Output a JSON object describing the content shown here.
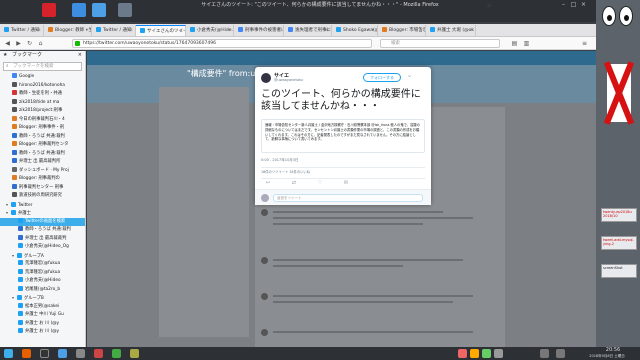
{
  "window": {
    "title": "サイエさんのツイート: \"このツイート、何らかの構成要件に該当してませんかね・・・\" - Mozilla Firefox"
  },
  "tabs": [
    {
      "label": "Twitter / 通知"
    },
    {
      "label": "Blogger: 教師・生"
    },
    {
      "label": "Twitter / 通知"
    },
    {
      "label": "サイエさんのツイー"
    },
    {
      "label": "小倉秀夫(@Hide..."
    },
    {
      "label": "刑事事件の被害者に"
    },
    {
      "label": "逸失理者で刑事になる"
    },
    {
      "label": "Shoko Egawa(@"
    },
    {
      "label": "Blogger: 市場告示"
    },
    {
      "label": "弁護士 大堀 (@ok"
    }
  ],
  "url": "https://twitter.com/uwaoyonetoku/status/17647093607496",
  "search_placeholder": "検索",
  "sidebar": {
    "title": "ブックマーク",
    "search_placeholder": "ブックマークを検索",
    "items": [
      {
        "label": "Google",
        "color": "#4285f4",
        "selected": false,
        "indent": 2
      },
      {
        "label": "hirono2016/kotonoha",
        "color": "#555555",
        "selected": false,
        "indent": 2
      },
      {
        "label": "教師・生徒を利・共通",
        "color": "#d33333",
        "selected": false,
        "indent": 2
      },
      {
        "label": "zik2018/tide at ma",
        "color": "#555555",
        "selected": false,
        "indent": 2
      },
      {
        "label": "zik2018/project:刑事",
        "color": "#555555",
        "selected": false,
        "indent": 2
      },
      {
        "label": "今日の刑事裁判石川・4",
        "color": "#e07b22",
        "selected": false,
        "indent": 2
      },
      {
        "label": "Blogger: 刑事事件・刑",
        "color": "#e07b22",
        "selected": false,
        "indent": 2
      },
      {
        "label": "教師・ろうば 共通:裁判",
        "color": "#2f6fd1",
        "selected": false,
        "indent": 2
      },
      {
        "label": "Blogger: 刑事裁判センタ",
        "color": "#e07b22",
        "selected": false,
        "indent": 2
      },
      {
        "label": "教師・ろうば 共通:裁判",
        "color": "#2f6fd1",
        "selected": false,
        "indent": 2
      },
      {
        "label": "弁理士 出 最高裁判所",
        "color": "#2f6fd1",
        "selected": false,
        "indent": 2
      },
      {
        "label": "ダッシュボード · My Proj",
        "color": "#666666",
        "selected": false,
        "indent": 2
      },
      {
        "label": "Blogger: 刑事裁判の",
        "color": "#e07b22",
        "selected": false,
        "indent": 2
      },
      {
        "label": "刑事裁判センター 刑事",
        "color": "#2f6fd1",
        "selected": false,
        "indent": 2
      },
      {
        "label": "鉄道技術の周研究研究",
        "color": "#555555",
        "selected": false,
        "indent": 2
      },
      {
        "label": "Twitter",
        "color": "#1da1f2",
        "selected": false,
        "indent": 1,
        "folder": true
      },
      {
        "label": "弁護士",
        "color": "#1da1f2",
        "selected": false,
        "indent": 1,
        "folder": true
      },
      {
        "label": "Twitterの画面を検索",
        "color": "#1da1f2",
        "selected": true,
        "indent": 3
      },
      {
        "label": "教師・ろうば 共通:裁判",
        "color": "#2f6fd1",
        "selected": false,
        "indent": 3
      },
      {
        "label": "弁理士 出 最高裁裁判",
        "color": "#2f6fd1",
        "selected": false,
        "indent": 3
      },
      {
        "label": "小倉秀夫(@Hideo_Og",
        "color": "#1da1f2",
        "selected": false,
        "indent": 3
      },
      {
        "label": "グループA",
        "color": "#1da1f2",
        "selected": false,
        "indent": 2,
        "folder": true
      },
      {
        "label": "荒澤隆宏(@fukua",
        "color": "#1da1f2",
        "selected": false,
        "indent": 3
      },
      {
        "label": "荒澤隆宏(@fukua",
        "color": "#1da1f2",
        "selected": false,
        "indent": 3
      },
      {
        "label": "小倉秀夫(@Hideo",
        "color": "#1da1f2",
        "selected": false,
        "indent": 3
      },
      {
        "label": "岩尾隆(@ta2ro_b",
        "color": "#1da1f2",
        "selected": false,
        "indent": 3
      },
      {
        "label": "グループB",
        "color": "#1da1f2",
        "selected": false,
        "indent": 2,
        "folder": true
      },
      {
        "label": "松本正男(@sakei",
        "color": "#1da1f2",
        "selected": false,
        "indent": 3
      },
      {
        "label": "弁護士 中川 Yuji Gu",
        "color": "#1da1f2",
        "selected": false,
        "indent": 3
      },
      {
        "label": "弁護士 お 川 (@y",
        "color": "#1da1f2",
        "selected": false,
        "indent": 3
      },
      {
        "label": "弁護士 お 川 (@y",
        "color": "#1da1f2",
        "selected": false,
        "indent": 3
      }
    ]
  },
  "twitter": {
    "search_title": "\"構成要件\" from:uwa",
    "modal": {
      "name": "サイエ",
      "handle": "@uwaoyonetoku",
      "follow_label": "フォローする",
      "tweet_text": "このツイート、何らかの構成要件に該当してませんかね・・・",
      "quote_text": "速報・市場告知センター新人弁護士 / 金沢地方検察庁 · 石川県警察本部 @Isk_Iruna 殺人の鬼で、容疑の詳細なものについてはまだです。センセントン弁護士の書類作業の市場の調査と、この書類の作成をお願いしてくれます。これはその方に、記者発表したのですがまだ見なされていません。その方に結論として、新鮮な事柄について書いてみます。",
      "time": "0:00 - 2017年10月3日",
      "stats": "16件のリツイート  34件のいいね",
      "reply_placeholder": "返信をツイート"
    }
  },
  "side_tiles": [
    {
      "label": "twenty-ep2018u 2018/10",
      "plain": false
    },
    {
      "label": "tweet-add-mysql-ying-2",
      "plain": false
    },
    {
      "label": "screenShot",
      "plain": true
    }
  ],
  "clock": {
    "time": "20:56",
    "date": "2018年9月8日 土曜日"
  },
  "colors": {
    "panel": "#2d3136",
    "twitter_blue": "#1da1f2",
    "selection": "#3daee9"
  }
}
